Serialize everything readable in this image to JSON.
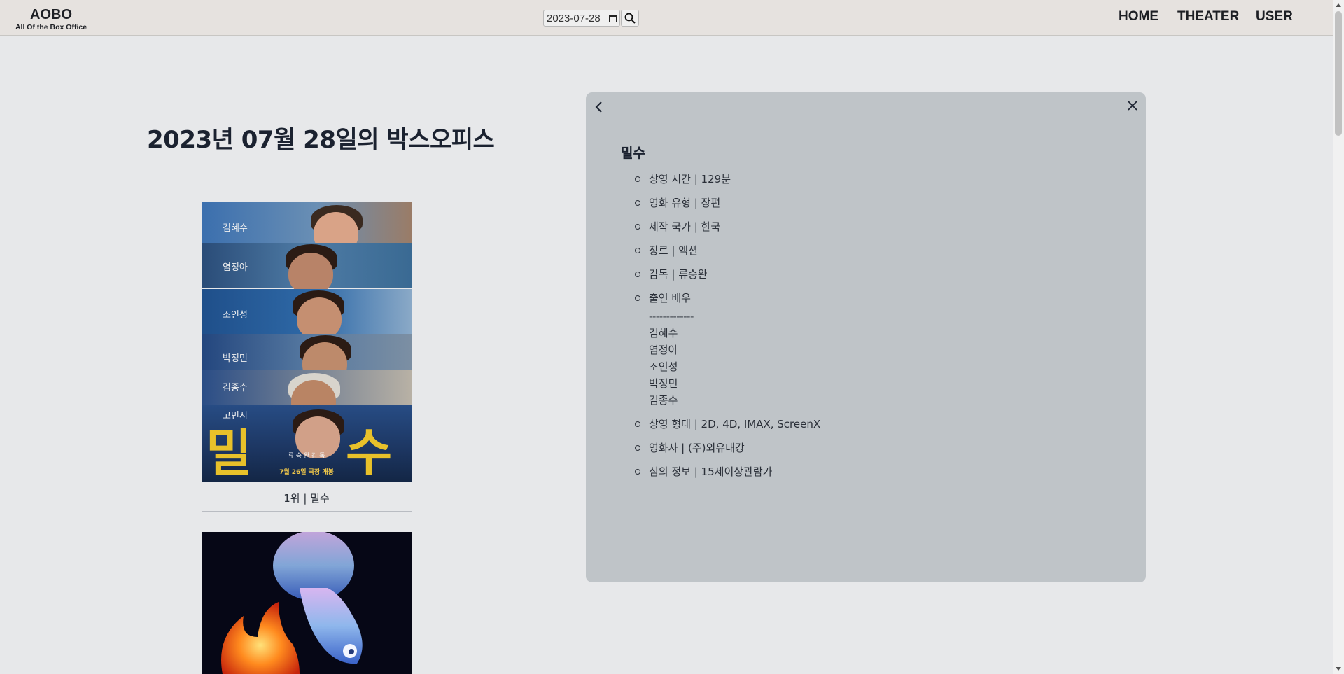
{
  "header": {
    "logo_title": "AOBO",
    "logo_subtitle": "All Of the Box Office",
    "date_value": "2023-07-28",
    "nav": [
      "HOME",
      "THEATER",
      "USER"
    ]
  },
  "main": {
    "title": "2023년 07월 28일의 박스오피스",
    "movies": [
      {
        "caption": "1위 | 밀수",
        "poster": {
          "cast_names": [
            "김혜수",
            "염정아",
            "조인성",
            "박정민",
            "김종수",
            "고민시"
          ],
          "title_left": "밀",
          "title_right": "수",
          "director": "류 승 완  감 독",
          "release": "7월 26일 극장 개봉"
        }
      },
      {
        "caption": ""
      }
    ]
  },
  "detail": {
    "movie_name": "밀수",
    "items": [
      "상영 시간 | 129분",
      "영화 유형 | 장편",
      "제작 국가 | 한국",
      "장르 | 액션",
      "감독 | 류승완",
      "출연 배우"
    ],
    "cast_separator": "-------------",
    "cast": [
      "김혜수",
      "염정아",
      "조인성",
      "박정민",
      "김종수"
    ],
    "items_after": [
      "상영 형태 | 2D, 4D, IMAX, ScreenX",
      "영화사 | (주)외유내강",
      "심의 정보 | 15세이상관람가"
    ]
  },
  "colors": {
    "page_bg": "#e7e8ea",
    "header_bg": "#e6e2df",
    "panel_bg": "#bfc4c8",
    "poster_title": "#e8c12a"
  },
  "icons": [
    "calendar-icon",
    "search-icon",
    "chevron-left-icon",
    "close-icon"
  ]
}
